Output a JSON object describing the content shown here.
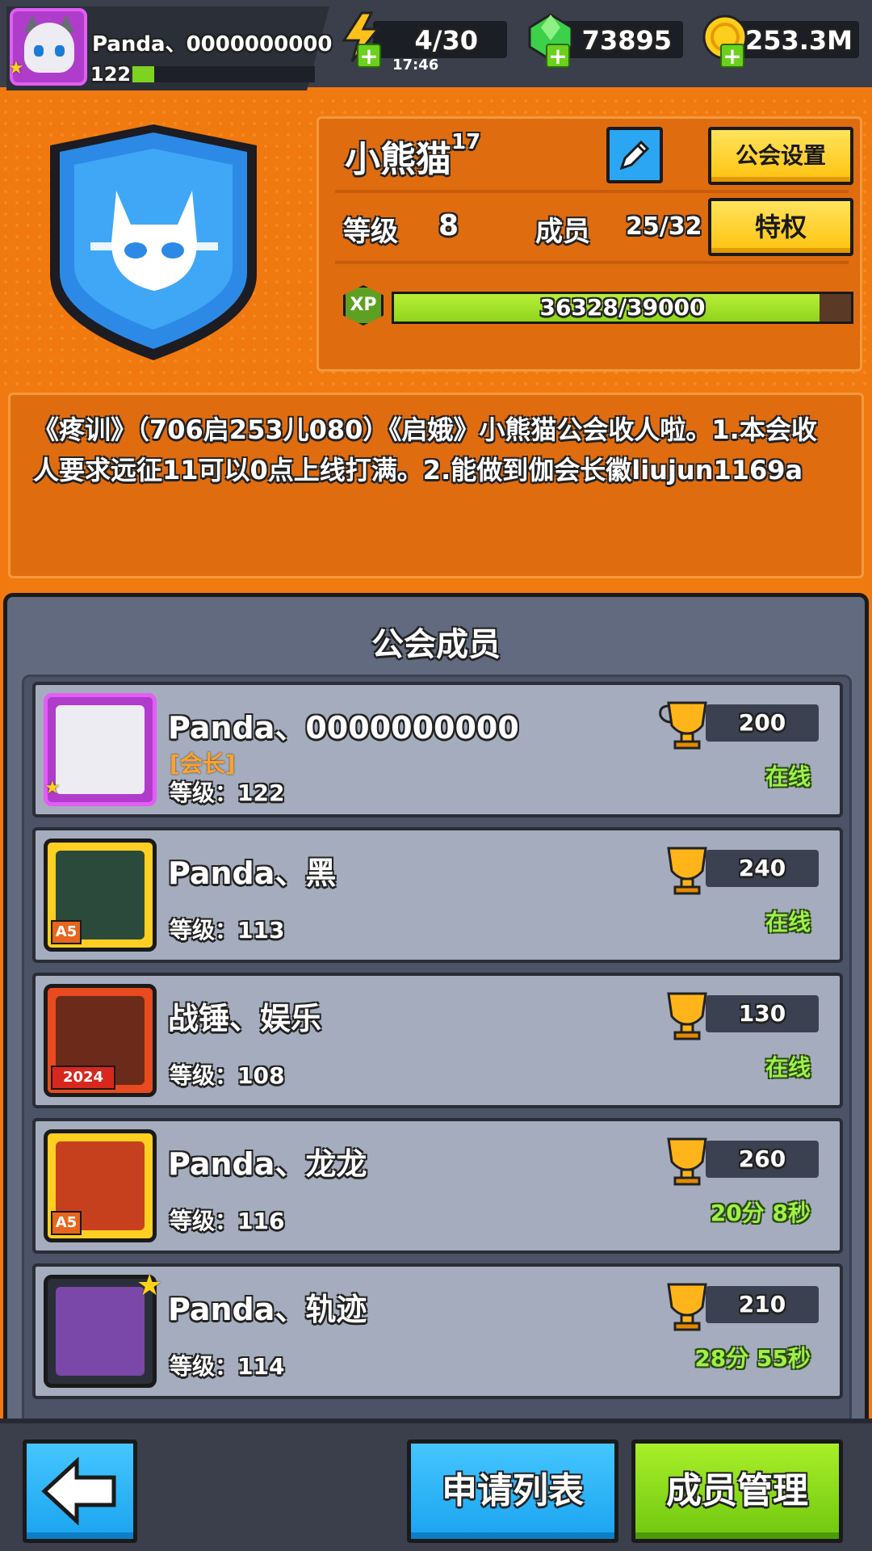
{
  "player": {
    "name": "Panda、0000000000",
    "level": "122"
  },
  "resources": {
    "energy": "4/30",
    "energy_timer": "17:46",
    "gems": "73895",
    "gold": "253.3M"
  },
  "guild": {
    "name": "小熊猫",
    "name_superscript": "17",
    "settings_label": "公会设置",
    "privilege_label": "特权",
    "level_label": "等级",
    "level_value": "8",
    "members_label": "成员",
    "members_value": "25/32",
    "xp_badge": "XP",
    "xp_text": "36328/39000",
    "xp_progress": 0.9315
  },
  "announcement": "《疼训》（706启253儿080）《启娥》小熊猫公会收人啦。1.本会收人要求远征11可以0点上线打满。2.能做到伽会长徽liujun1169a",
  "members_panel": {
    "title": "公会成员",
    "members": [
      {
        "name": "Panda、0000000000",
        "role": "[会长]",
        "level": "等级：122",
        "trophies": "200",
        "status": "在线",
        "avatar": "cat-avatar"
      },
      {
        "name": "Panda、黑",
        "role": "",
        "level": "等级：113",
        "trophies": "240",
        "status": "在线",
        "avatar": "panda-avatar",
        "tag": "A5"
      },
      {
        "name": "战锤、娱乐",
        "role": "",
        "level": "等级：108",
        "trophies": "130",
        "status": "在线",
        "avatar": "goggles-avatar",
        "tag": "2024"
      },
      {
        "name": "Panda、龙龙",
        "role": "",
        "level": "等级：116",
        "trophies": "260",
        "status": "20分 8秒",
        "avatar": "redhair-avatar",
        "tag": "A5"
      },
      {
        "name": "Panda、轨迹",
        "role": "",
        "level": "等级：114",
        "trophies": "210",
        "status": "28分 55秒",
        "avatar": "starfish-avatar"
      }
    ]
  },
  "bottom": {
    "apply_list_label": "申请列表",
    "member_manage_label": "成员管理"
  },
  "colors": {
    "background": "#f07a10",
    "panel": "#e06c10",
    "members_bg": "#616a7e",
    "row_bg": "#a5acbd",
    "online_green": "#9ff04a",
    "blue_button": "#1aa3ef",
    "green_button": "#6fc70e"
  }
}
